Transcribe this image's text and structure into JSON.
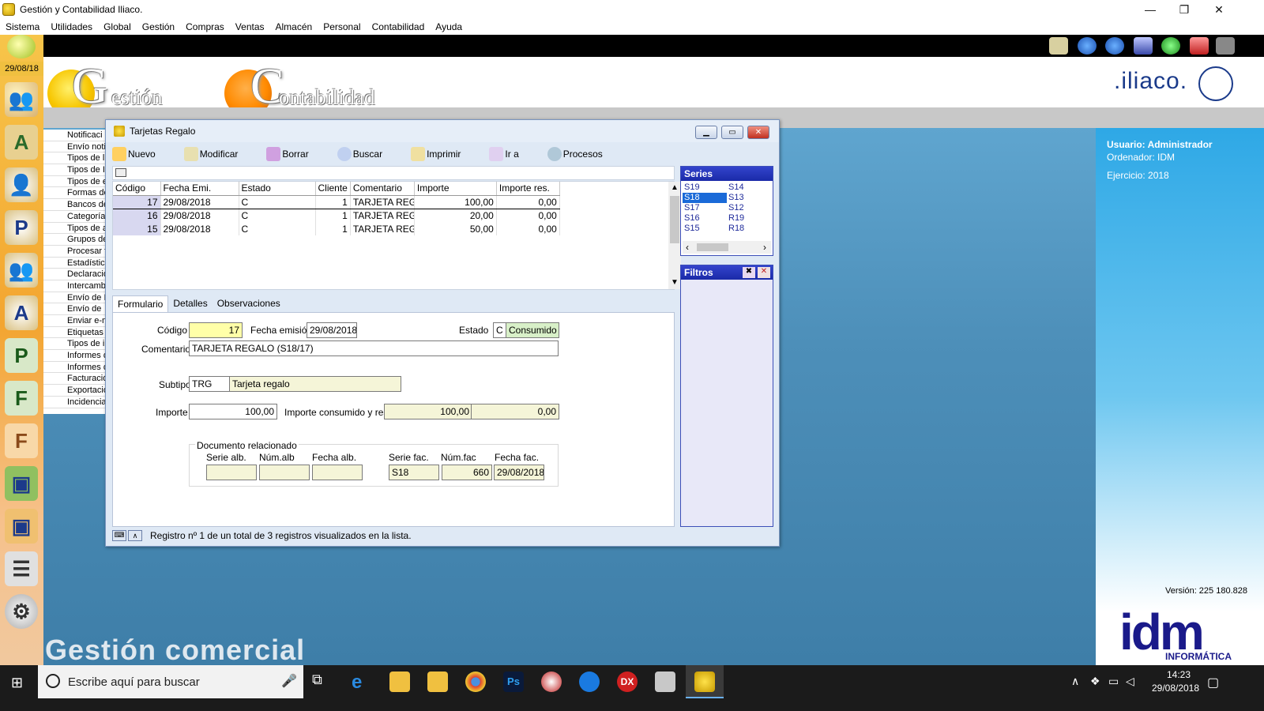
{
  "window": {
    "title": "Gestión y Contabilidad Iliaco.",
    "minimize": "—",
    "restore": "❐",
    "close": "✕"
  },
  "menu": [
    "Sistema",
    "Utilidades",
    "Global",
    "Gestión",
    "Compras",
    "Ventas",
    "Almacén",
    "Personal",
    "Contabilidad",
    "Ayuda"
  ],
  "sidebar": {
    "date": "29/08/18"
  },
  "header": {
    "logo_gestion": "estión",
    "logo_contabilidad": "ontabilidad",
    "brand": ".iliaco."
  },
  "bg_list": [
    "Notificaci",
    "Envío noti",
    "Tipos de l",
    "Tipos de I",
    "Tipos de e",
    "Formas de",
    "Bancos de",
    "Categorías",
    "Tipos de a",
    "Grupos de",
    "Procesar f",
    "Estadístic",
    "Declaracio",
    "Intercambi",
    "Envío de I",
    "Envío de",
    "Enviar e-m",
    "Etiquetas",
    "Tipos de ir",
    "Informes d",
    "Informes d",
    "Facturació",
    "Exportació",
    "Incidencia"
  ],
  "info": {
    "usuario": "Usuario: Administrador",
    "ordenador": "Ordenador: IDM",
    "ejercicio": "Ejercicio: 2018",
    "version": "Versión: 225 180.828",
    "footer_title": "Gestión comercial",
    "idm": "idm",
    "informatica": "INFORMÁTICA"
  },
  "dialog": {
    "title": "Tarjetas Regalo",
    "toolbar": [
      "Nuevo",
      "Modificar",
      "Borrar",
      "Buscar",
      "Imprimir",
      "Ir a",
      "Procesos"
    ],
    "columns": [
      "Código",
      "Fecha Emi.",
      "Estado",
      "Cliente",
      "Comentario",
      "Importe",
      "Importe res."
    ],
    "rows": [
      {
        "codigo": "17",
        "fecha": "29/08/2018",
        "estado": "C",
        "cliente": "1",
        "comentario": "TARJETA REGA",
        "importe": "100,00",
        "res": "0,00"
      },
      {
        "codigo": "16",
        "fecha": "29/08/2018",
        "estado": "C",
        "cliente": "1",
        "comentario": "TARJETA REGA",
        "importe": "20,00",
        "res": "0,00"
      },
      {
        "codigo": "15",
        "fecha": "29/08/2018",
        "estado": "C",
        "cliente": "1",
        "comentario": "TARJETA REGA",
        "importe": "50,00",
        "res": "0,00"
      }
    ],
    "tabs": [
      "Formulario",
      "Detalles",
      "Observaciones"
    ],
    "form": {
      "codigo_label": "Código",
      "codigo": "17",
      "fecha_label": "Fecha emisión",
      "fecha": "29/08/2018",
      "estado_label": "Estado",
      "estado_code": "C",
      "estado_text": "Consumido",
      "comentario_label": "Comentario",
      "comentario": "TARJETA REGALO (S18/17)",
      "subtipo_label": "Subtipo",
      "subtipo_code": "TRG",
      "subtipo_text": "Tarjeta regalo",
      "importe_label": "Importe",
      "importe": "100,00",
      "consumido_label": "Importe consumido y rest.",
      "consumido": "100,00",
      "restante": "0,00",
      "doc_label": "Documento relacionado",
      "serie_alb_label": "Serie alb.",
      "num_alb_label": "Núm.alb",
      "fecha_alb_label": "Fecha alb.",
      "serie_fac_label": "Serie fac.",
      "num_fac_label": "Núm.fac",
      "fecha_fac_label": "Fecha fac.",
      "serie_fac": "S18",
      "num_fac": "660",
      "fecha_fac": "29/08/2018"
    },
    "status": "Registro nº 1 de un total de 3 registros visualizados en la lista.",
    "series_title": "Series",
    "series": [
      [
        "S19",
        "S14"
      ],
      [
        "S18",
        "S13"
      ],
      [
        "S17",
        "S12"
      ],
      [
        "S16",
        "R19"
      ],
      [
        "S15",
        "R18"
      ]
    ],
    "filtros_title": "Filtros"
  },
  "taskbar": {
    "search_placeholder": "Escribe aquí para buscar",
    "time": "14:23",
    "date": "29/08/2018"
  },
  "colors": {
    "accent": "#3344cc",
    "main_bg": "#4d8fb9",
    "sidebar": "#f3a530"
  }
}
